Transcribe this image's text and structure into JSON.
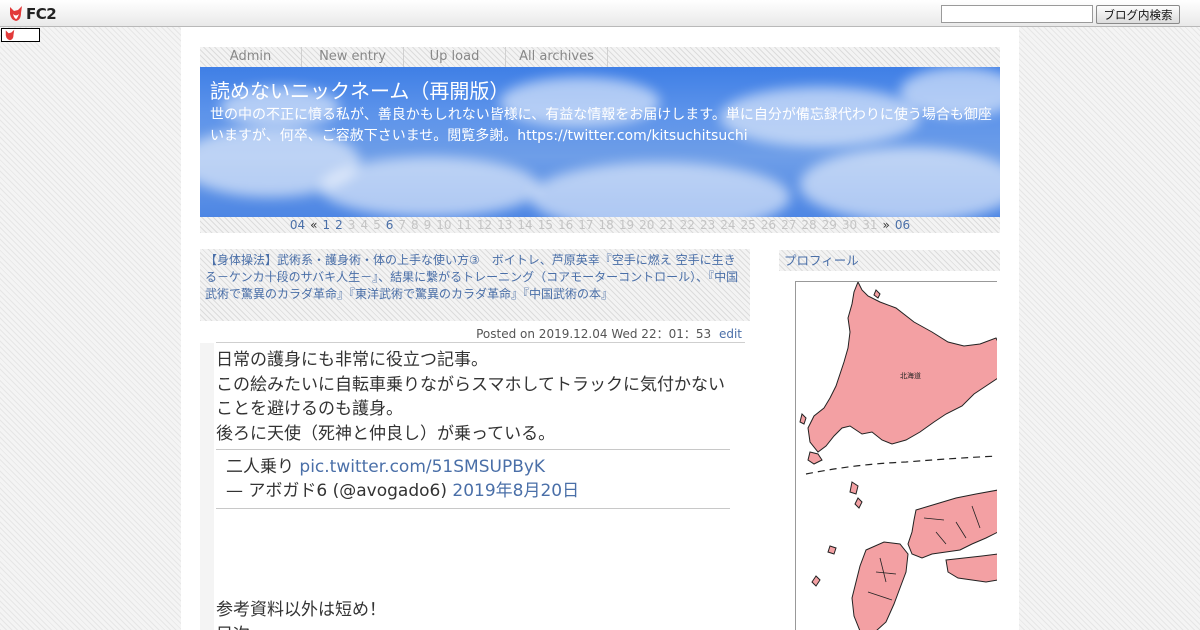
{
  "fc2": {
    "logo_text": "FC2",
    "search_placeholder": "",
    "search_button": "ブログ内検索"
  },
  "nav": [
    "Admin",
    "New entry",
    "Up load",
    "All archives"
  ],
  "header": {
    "title": "読めないニックネーム（再開版）",
    "description": "世の中の不正に憤る私が、善良かもしれない皆様に、有益な情報をお届けします。単に自分が備忘録代わりに使う場合も御座いますが、何卒、ご容赦下さいませ。閲覧多謝。https://twitter.com/kitsuchitsuchi"
  },
  "calendar": {
    "prev_month": "04",
    "prev_arrow": "«",
    "next_arrow": "»",
    "next_month": "06",
    "days": [
      "1",
      "2",
      "3",
      "4",
      "5",
      "6",
      "7",
      "8",
      "9",
      "10",
      "11",
      "12",
      "13",
      "14",
      "15",
      "16",
      "17",
      "18",
      "19",
      "20",
      "21",
      "22",
      "23",
      "24",
      "25",
      "26",
      "27",
      "28",
      "29",
      "30",
      "31"
    ],
    "linked_days": [
      "1",
      "2",
      "6"
    ]
  },
  "entry": {
    "title": "【身体操法】武術系・護身術・体の上手な使い方③　ボイトレ、芦原英幸『空手に燃え 空手に生きる－ケンカ十段のサバキ人生－』、結果に繋がるトレーニング（コアモーターコントロール）、『中国武術で驚異のカラダ革命』『東洋武術で驚異のカラダ革命』『中国武術の本』",
    "posted": "Posted on 2019.12.04 Wed 22：01：53",
    "edit": "edit",
    "body_lines": [
      "日常の護身にも非常に役立つ記事。",
      "この絵みたいに自転車乗りながらスマホしてトラックに気付かないことを避けるのも護身。",
      "後ろに天使（死神と仲良し）が乗っている。"
    ],
    "tweet": {
      "text": "二人乗り",
      "link": "pic.twitter.com/51SMSUPByK",
      "author": "— アボガド6 (@avogado6)",
      "date": "2019年8月20日"
    },
    "body_lines2": [
      "参考資料以外は短め！",
      "目次"
    ]
  },
  "sidebar": {
    "profile_title": "プロフィール"
  },
  "colors": {
    "link": "#4a6fa8",
    "header_blue": "#4a86e6",
    "map_pink": "#f3a0a3"
  }
}
